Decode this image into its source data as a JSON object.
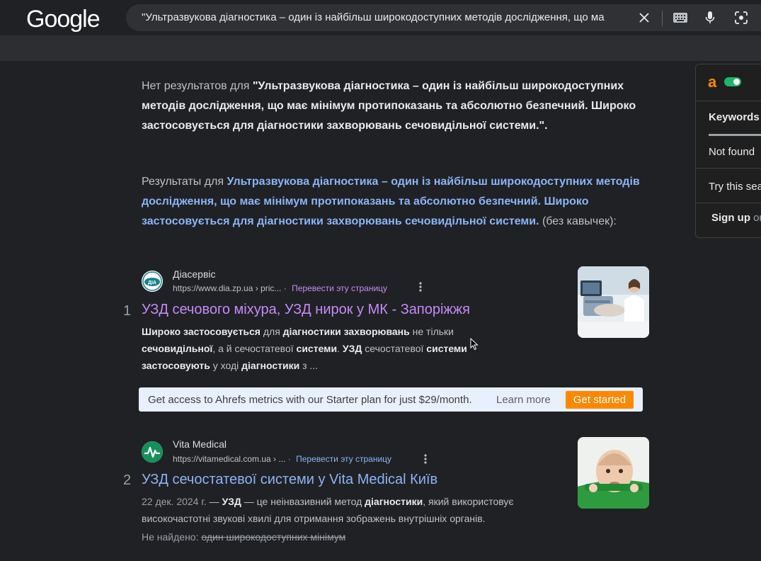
{
  "header": {
    "logo": "Google",
    "query": "\"Ультразвукова діагностика – один із найбільш широкодоступних методів дослідження, що ма"
  },
  "no_results": {
    "prefix": "Нет результатов для ",
    "query": "\"Ультразвукова діагностика – один із найбільш широкодоступних методів дослідження, що має мінімум протипоказань та абсолютно безпечний. Широко застосовується для діагностики захворювань сечовидільної системи.\"",
    "suffix": "."
  },
  "showing_for": {
    "prefix": "Результаты для ",
    "query": "Ультразвукова діагностика – один із найбільш широкодоступних методів дослідження, що має мінімум протипоказань та абсолютно безпечний. Широко застосовується для діагностики захворювань сечовидільної системи.",
    "suffix": " (без кавычек):"
  },
  "results": [
    {
      "number": "1",
      "site_name": "Діасервіс",
      "url": "https://www.dia.zp.ua › pric...",
      "translate": "Перевести эту страницу",
      "title": "УЗД сечового міхура, УЗД нирок у МК - Запоріжжя",
      "title_color": "#c58af9"
    },
    {
      "number": "2",
      "site_name": "Vita Medical",
      "url": "https://vitamedical.com.ua › ...",
      "translate": "Перевести эту страницу",
      "title": "УЗД сечостатевої системи у Vita Medical Київ",
      "title_color": "#8ab4f8",
      "date": "22 дек. 2024 г.",
      "missing_label": "Не найдено:",
      "missing_terms": "один широкодоступних мінімум"
    }
  ],
  "snippet1": {
    "parts": [
      "Широко застосовується",
      " для ",
      "діагностики захворювань",
      " не тільки ",
      "сечовидільної",
      ", а й сечостатевої ",
      "системи",
      ". ",
      "УЗД",
      " сечостатевої ",
      "системи",
      " ",
      "застосовують",
      " у ході ",
      "діагностики",
      " з ..."
    ]
  },
  "snippet2": {
    "parts": [
      " — ",
      "УЗД",
      " — це неінвазивний метод ",
      "діагностики",
      ", який використовує високочастотні звукові хвилі для отримання зображень внутрішніх органів."
    ]
  },
  "ahrefs_bar": {
    "text": "Get access to Ahrefs metrics with our Starter plan for just $29/month.",
    "learn_more": "Learn more",
    "button": "Get started"
  },
  "sidebar": {
    "logo": "a",
    "tab": "Keywords",
    "status": "Not found",
    "try_text": "Try this sea",
    "signup": "Sign up",
    "signup_suffix": " or"
  },
  "colors": {
    "background": "#202124",
    "link_visited": "#c58af9",
    "link": "#8ab4f8",
    "ahrefs_orange": "#ff8800"
  }
}
